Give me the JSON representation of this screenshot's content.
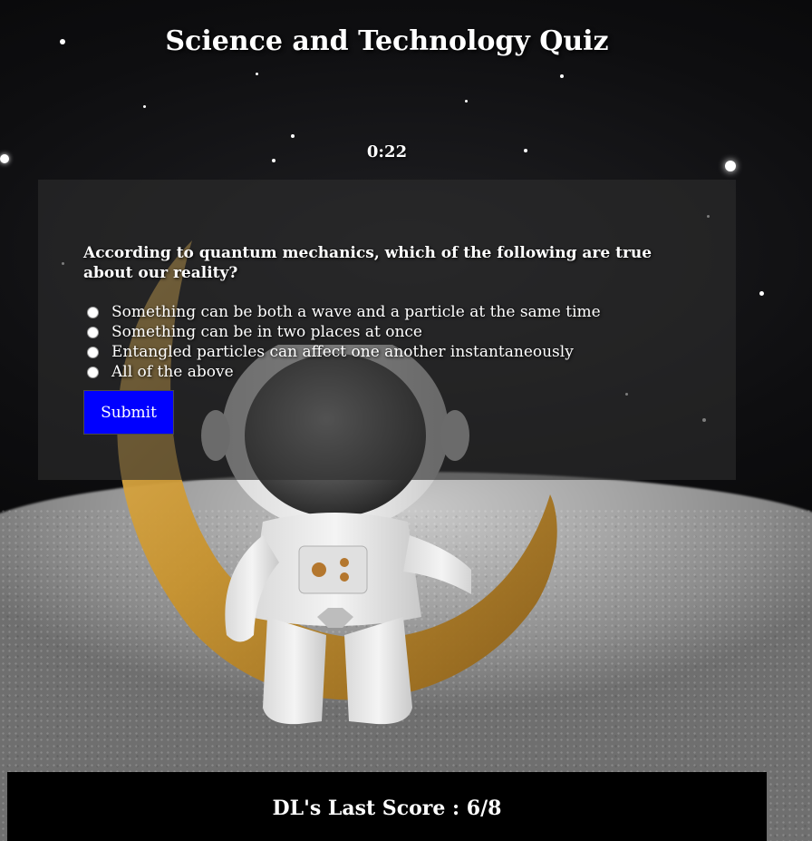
{
  "app": {
    "title": "Science and Technology Quiz",
    "timer": "0:22"
  },
  "quiz": {
    "question": "According to quantum mechanics, which of the following are true about our reality?",
    "options": [
      "Something can be both a wave and a particle at the same time",
      "Something can be in two places at once",
      "Entangled particles can affect one another instantaneously",
      "All of the above"
    ],
    "selected_option": null,
    "submit_label": "Submit"
  },
  "footer": {
    "score_text": "DL's Last Score : 6/8"
  },
  "colors": {
    "submit_bg": "#0000ff",
    "card_bg": "rgba(45,45,45,0.62)",
    "footer_bg": "#000000",
    "text": "#ffffff",
    "moon_gold": "#c8932e"
  },
  "background": {
    "scene": "astronaut-on-crescent-moon",
    "icons": [
      "star-icon",
      "crescent-moon-icon",
      "astronaut-icon"
    ]
  }
}
